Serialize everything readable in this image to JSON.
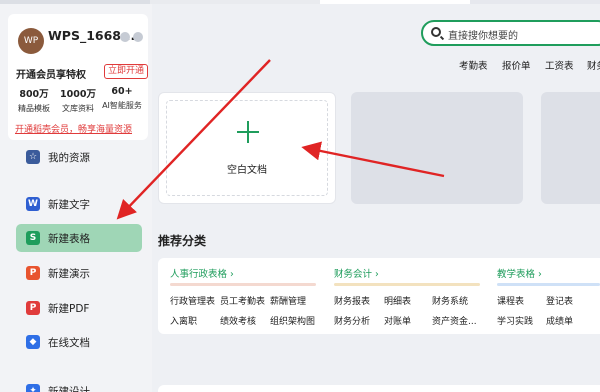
{
  "profile": {
    "avatar_text": "WP",
    "username": "WPS_1668...",
    "vip_title": "开通会员享特权",
    "vip_button": "立即开通",
    "stats": [
      {
        "value": "800万",
        "label": "精品模板"
      },
      {
        "value": "1000万",
        "label": "文库资料"
      },
      {
        "value": "60+",
        "label": "AI智能服务"
      }
    ],
    "promo": "开通稻壳会员，畅享海量资源"
  },
  "nav": [
    {
      "label": "我的资源",
      "icon": "resource-icon",
      "color": "#3b5b9b"
    },
    {
      "label": "新建文字",
      "icon": "word-icon",
      "color": "#2f5fd1"
    },
    {
      "label": "新建表格",
      "icon": "sheet-icon",
      "color": "#1f9d5c",
      "active": true
    },
    {
      "label": "新建演示",
      "icon": "slides-icon",
      "color": "#e8542f"
    },
    {
      "label": "新建PDF",
      "icon": "pdf-icon",
      "color": "#e03b3b"
    },
    {
      "label": "在线文档",
      "icon": "online-doc-icon",
      "color": "#2f6fe6"
    },
    {
      "label": "新建设计",
      "icon": "design-icon",
      "color": "#2f6fe6"
    }
  ],
  "search": {
    "placeholder": "直接搜你想要的"
  },
  "quick_links": [
    "考勤表",
    "报价单",
    "工资表",
    "财务"
  ],
  "blank_card": {
    "label": "空白文档"
  },
  "recommend": {
    "title": "推荐分类",
    "categories": [
      {
        "title": "人事行政表格",
        "items": [
          "行政管理表",
          "员工考勤表",
          "薪酬管理",
          "入离职",
          "绩效考核",
          "组织架构图"
        ]
      },
      {
        "title": "财务会计",
        "items": [
          "财务报表",
          "明细表",
          "财务系统",
          "财务分析",
          "对账单",
          "资产资金..."
        ]
      },
      {
        "title": "教学表格",
        "items": [
          "课程表",
          "登记表",
          "学习实践",
          "成绩单"
        ]
      }
    ]
  },
  "colors": {
    "accent": "#1f9d5c",
    "active_bg": "#9fd6b6",
    "arrow": "#e02424",
    "promo": "#e03b3b"
  }
}
